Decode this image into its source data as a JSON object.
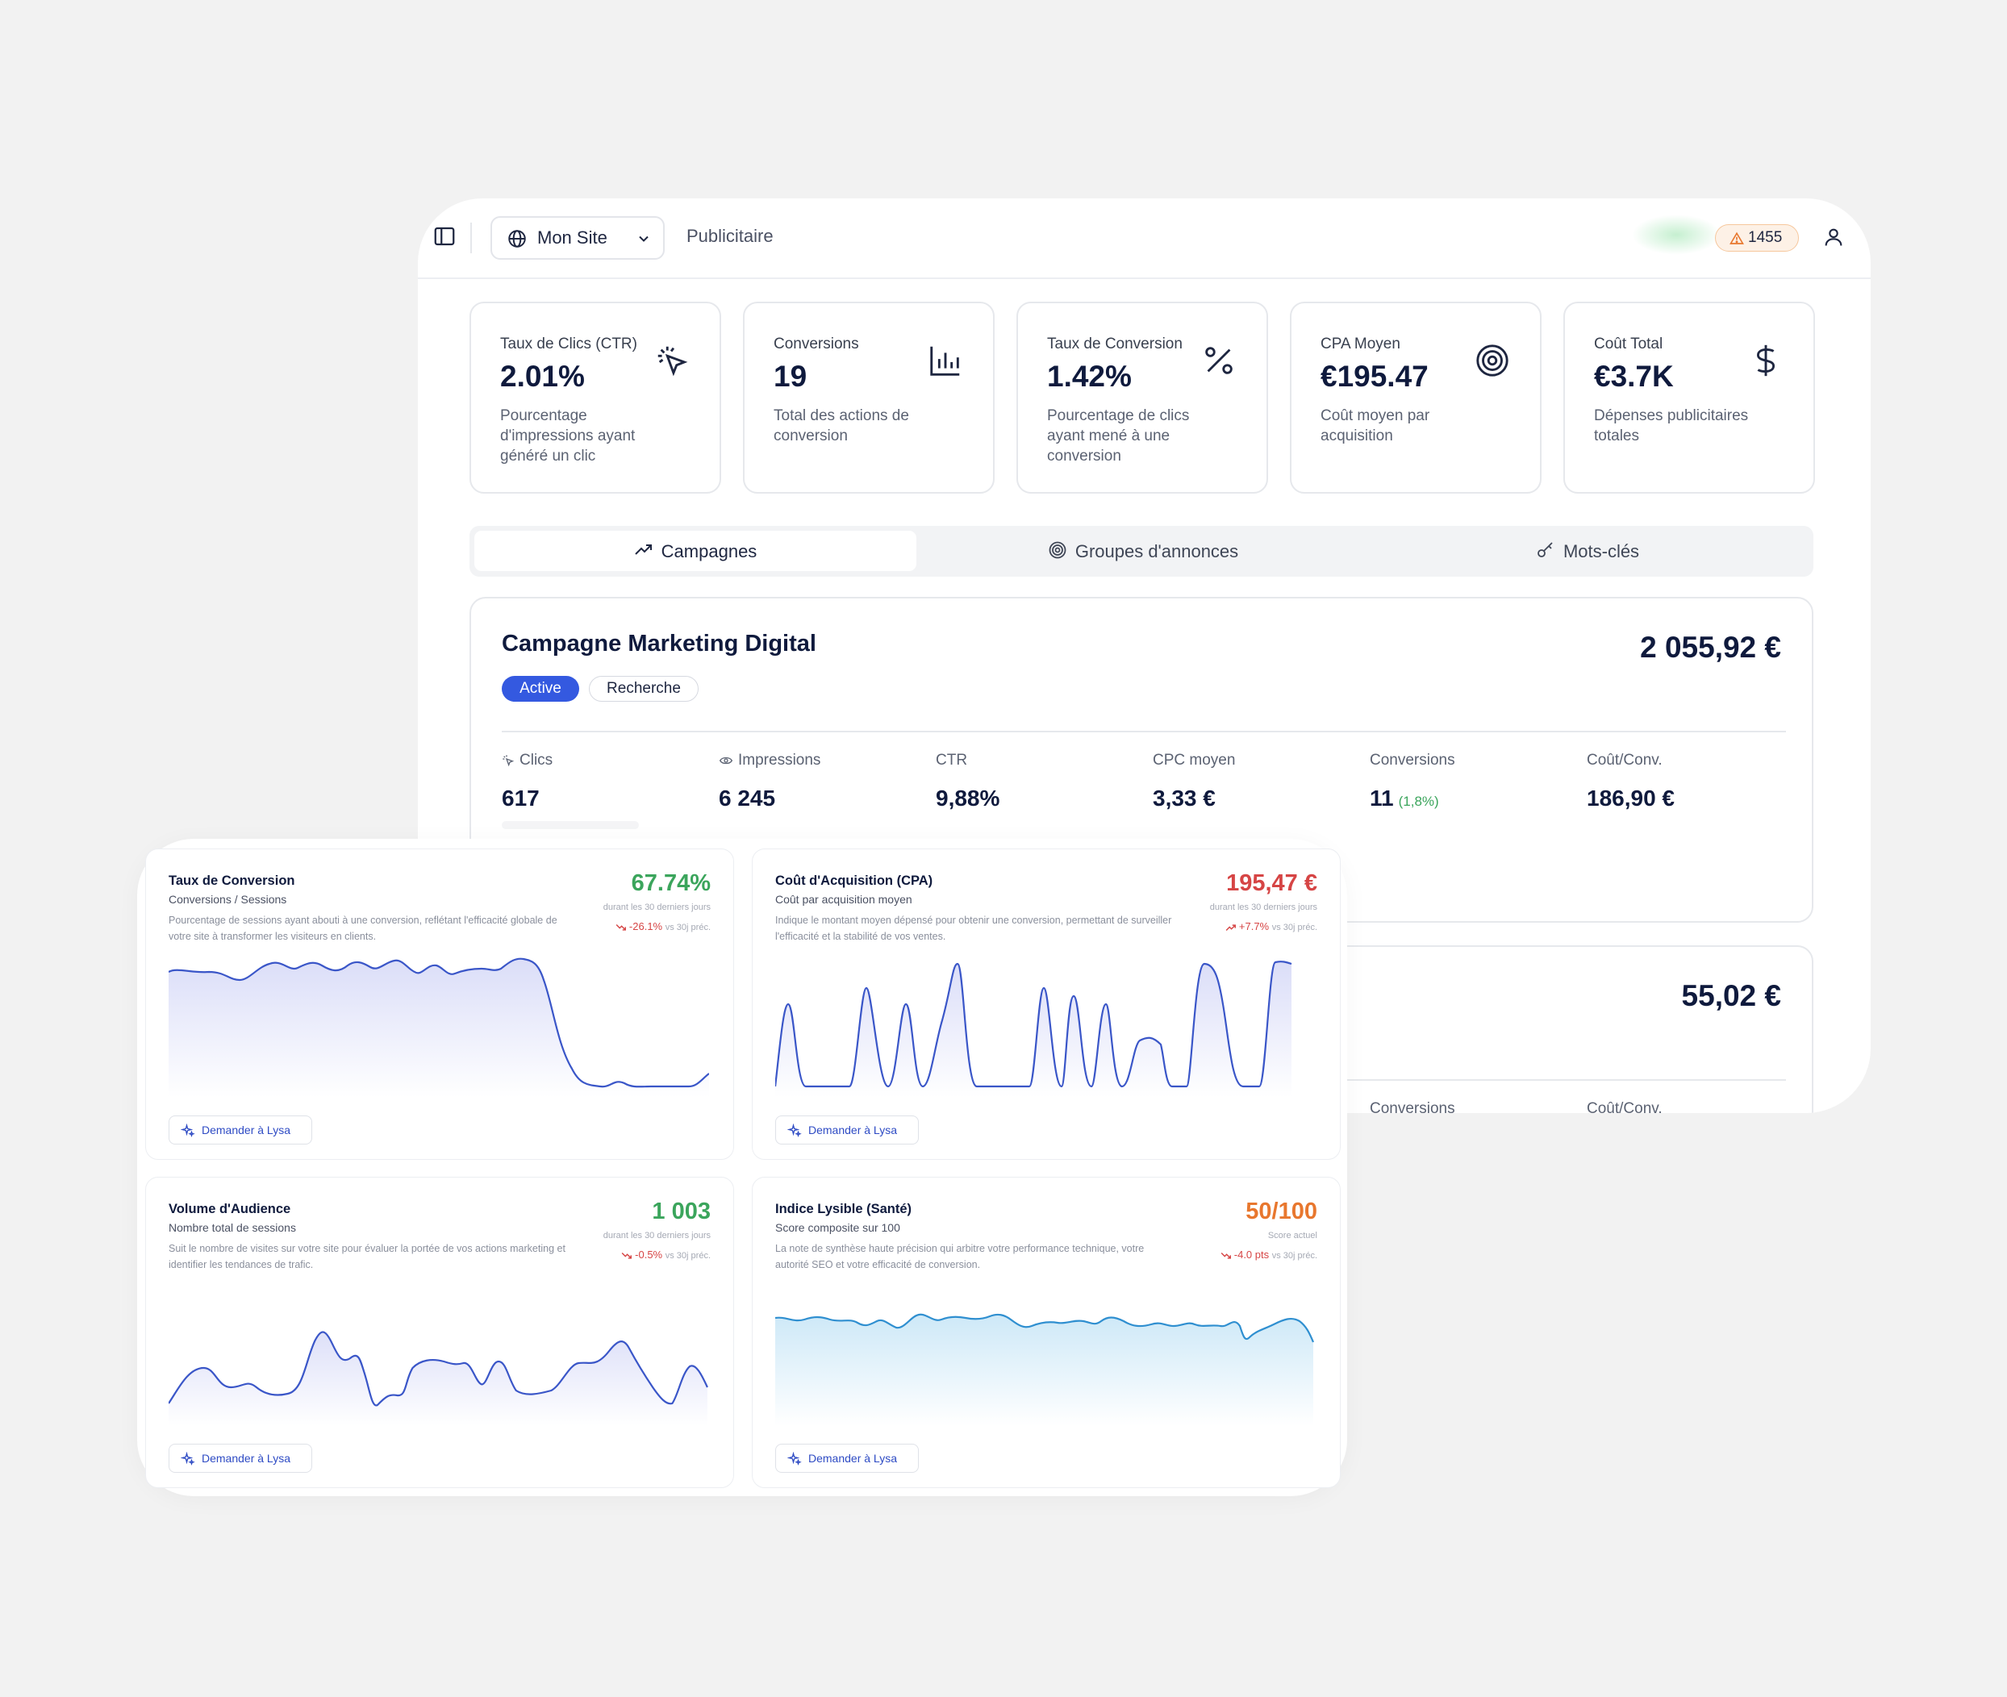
{
  "topbar": {
    "site_label": "Mon Site",
    "section": "Publicitaire",
    "alert_count": "1455"
  },
  "kpis": [
    {
      "title": "Taux de Clics (CTR)",
      "value": "2.01%",
      "desc": "Pourcentage d'impressions ayant généré un clic",
      "icon": "pointer-click-icon"
    },
    {
      "title": "Conversions",
      "value": "19",
      "desc": "Total des actions de conversion",
      "icon": "bar-chart-icon"
    },
    {
      "title": "Taux de Conversion",
      "value": "1.42%",
      "desc": "Pourcentage de clics ayant mené à une conversion",
      "icon": "percent-icon"
    },
    {
      "title": "CPA Moyen",
      "value": "€195.47",
      "desc": "Coût moyen par acquisition",
      "icon": "target-icon"
    },
    {
      "title": "Coût Total",
      "value": "€3.7K",
      "desc": "Dépenses publicitaires totales",
      "icon": "dollar-icon"
    }
  ],
  "tabs": [
    {
      "label": "Campagnes",
      "icon": "trend-up-icon",
      "selected": true
    },
    {
      "label": "Groupes d'annonces",
      "icon": "target-icon",
      "selected": false
    },
    {
      "label": "Mots-clés",
      "icon": "key-icon",
      "selected": false
    }
  ],
  "campaign": {
    "name": "Campagne Marketing Digital",
    "amount": "2 055,92 €",
    "status": "Active",
    "type": "Recherche",
    "metrics": [
      {
        "label": "Clics",
        "value": "617"
      },
      {
        "label": "Impressions",
        "value": "6 245"
      },
      {
        "label": "CTR",
        "value": "9,88%"
      },
      {
        "label": "CPC moyen",
        "value": "3,33 €"
      },
      {
        "label": "Conversions",
        "value": "11",
        "extra": "(1,8%)"
      },
      {
        "label": "Coût/Conv.",
        "value": "186,90 €"
      }
    ]
  },
  "campaign2": {
    "amount": "55,02 €",
    "col_conversions": "Conversions",
    "col_cost": "Coût/Conv."
  },
  "cards": [
    {
      "title": "Taux de Conversion",
      "subtitle": "Conversions / Sessions",
      "desc": "Pourcentage de sessions ayant abouti à une conversion, reflétant l'efficacité globale de votre site à transformer les visiteurs en clients.",
      "value": "67.74%",
      "value_color": "#3ba55c",
      "period": "durant les 30 derniers jours",
      "change": "-26.1%",
      "change_suffix": "vs 30j préc.",
      "ask": "Demander à Lysa"
    },
    {
      "title": "Coût d'Acquisition (CPA)",
      "subtitle": "Coût par acquisition moyen",
      "desc": "Indique le montant moyen dépensé pour obtenir une conversion, permettant de surveiller l'efficacité et la stabilité de vos ventes.",
      "value": "195,47 €",
      "value_color": "#d64545",
      "period": "durant les 30 derniers jours",
      "change": "+7.7%",
      "change_suffix": "vs 30j préc.",
      "ask": "Demander à Lysa"
    },
    {
      "title": "Volume d'Audience",
      "subtitle": "Nombre total de sessions",
      "desc": "Suit le nombre de visites sur votre site pour évaluer la portée de vos actions marketing et identifier les tendances de trafic.",
      "value": "1 003",
      "value_color": "#3ba55c",
      "period": "durant les 30 derniers jours",
      "change": "-0.5%",
      "change_suffix": "vs 30j préc.",
      "ask": "Demander à Lysa"
    },
    {
      "title": "Indice Lysible (Santé)",
      "subtitle": "Score composite sur 100",
      "desc": "La note de synthèse haute précision qui arbitre votre performance technique, votre autorité SEO et votre efficacité de conversion.",
      "value": "50/100",
      "value_color": "#e8772e",
      "period": "Score actuel",
      "change": "-4.0 pts",
      "change_suffix": "vs 30j préc.",
      "ask": "Demander à Lysa"
    }
  ]
}
